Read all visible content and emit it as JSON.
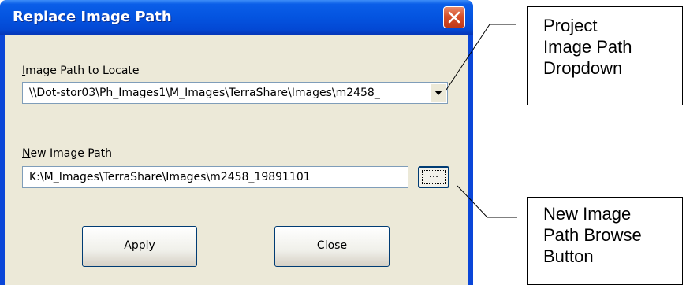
{
  "dialog": {
    "title": "Replace Image Path",
    "locate_label_accel": "I",
    "locate_label_rest": "mage Path to Locate",
    "locate_value": "\\\\Dot-stor03\\Ph_Images1\\M_Images\\TerraShare\\Images\\m2458_",
    "new_label_accel": "N",
    "new_label_rest": "ew Image Path",
    "new_value": "K:\\M_Images\\TerraShare\\Images\\m2458_19891101",
    "browse_label": "...",
    "apply_accel": "A",
    "apply_rest": "pply",
    "close_accel": "C",
    "close_rest": "lose"
  },
  "callouts": {
    "dropdown": [
      "Project",
      "Image Path",
      "Dropdown"
    ],
    "browse": [
      "New Image",
      "Path Browse",
      "Button"
    ]
  },
  "icons": {
    "close": "close-x-icon",
    "dropdown": "triangle-down-icon"
  },
  "colors": {
    "titlebar": "#0454e0",
    "close_button": "#d7502a",
    "dialog_face": "#ece9d8",
    "field_border": "#7f9db9"
  }
}
